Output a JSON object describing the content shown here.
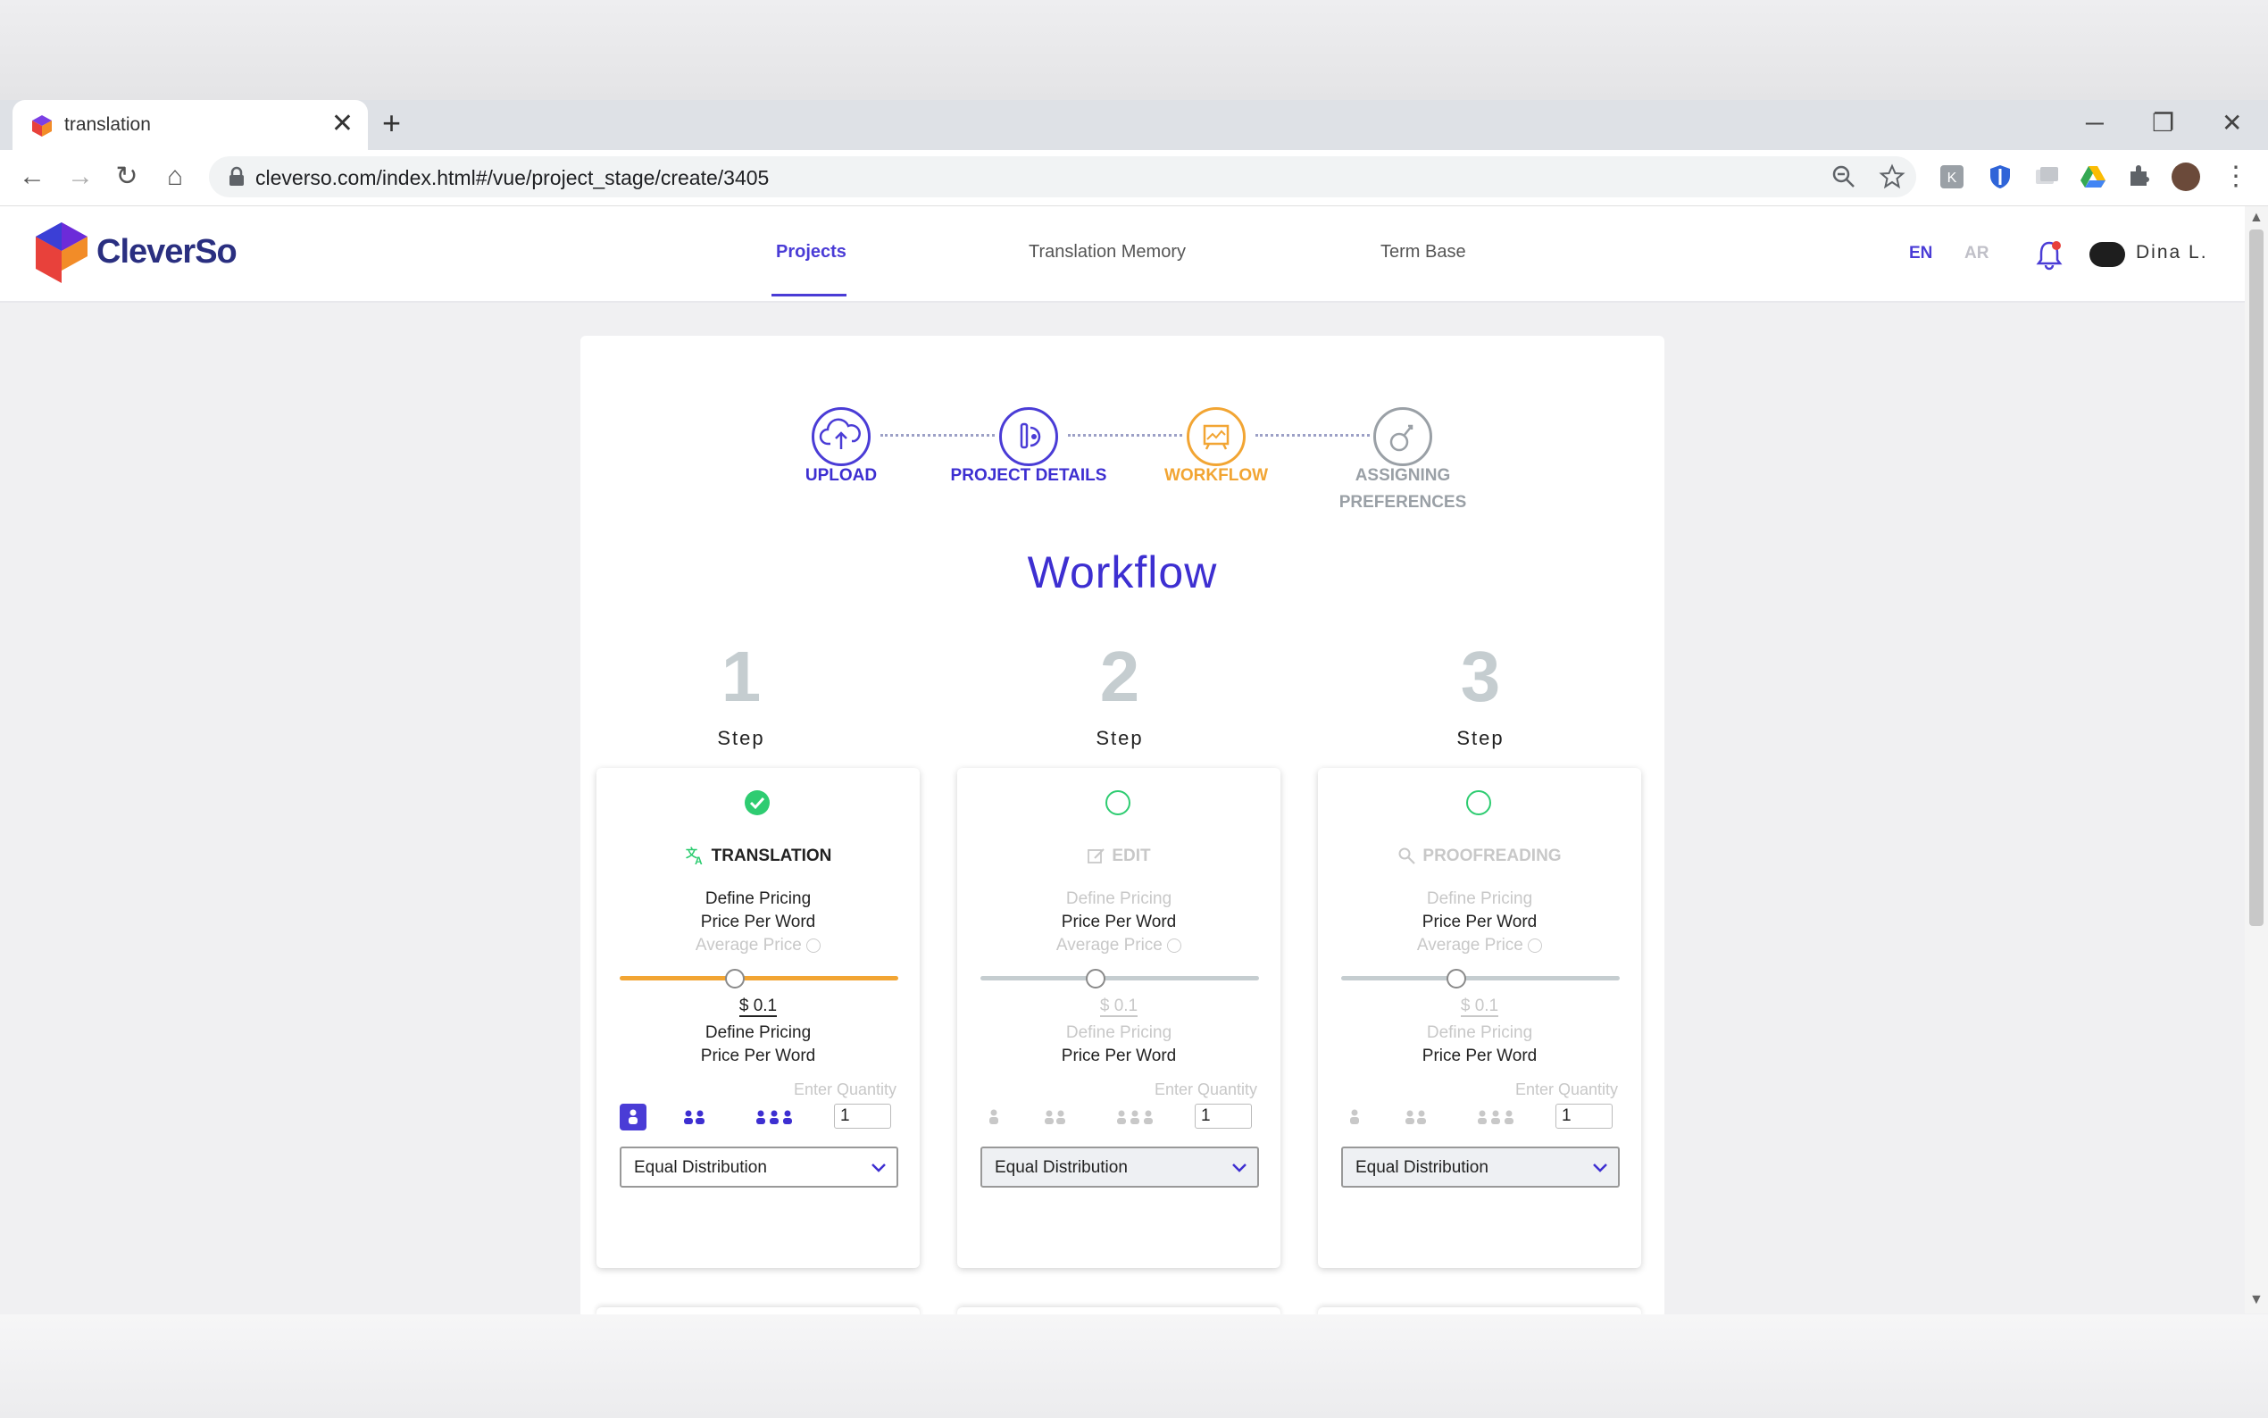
{
  "browser": {
    "tab_title": "translation",
    "url": "cleverso.com/index.html#/vue/project_stage/create/3405",
    "new_tab_symbol": "+",
    "close_symbol": "✕",
    "minimize_symbol": "─",
    "restore_symbol": "❐",
    "window_close_symbol": "✕",
    "back_symbol": "←",
    "forward_symbol": "→",
    "reload_symbol": "↻",
    "home_symbol": "⌂",
    "menu_symbol": "⋮"
  },
  "app": {
    "logo_text": "CleverSo",
    "nav": [
      {
        "label": "Projects",
        "active": true
      },
      {
        "label": "Translation Memory",
        "active": false
      },
      {
        "label": "Term Base",
        "active": false
      }
    ],
    "lang_en": "EN",
    "lang_ar": "AR",
    "user_name": "Dina L.",
    "accent": "#4a3cd6",
    "orange": "#f2a533",
    "green": "#2ecc71"
  },
  "stepper": [
    {
      "label": "UPLOAD",
      "state": "done",
      "icon": "cloud-upload-icon"
    },
    {
      "label": "PROJECT DETAILS",
      "state": "done",
      "icon": "details-icon"
    },
    {
      "label": "WORKFLOW",
      "state": "active",
      "icon": "workflow-icon"
    },
    {
      "label_line1": "ASSIGNING",
      "label_line2": "PREFERENCES",
      "state": "pending",
      "icon": "preferences-icon"
    }
  ],
  "page_title": "Workflow",
  "steps": [
    {
      "number": "1",
      "step_label": "Step",
      "title": "TRANSLATION",
      "enabled": true,
      "slider_value": 0.41,
      "define_pricing": "Define Pricing",
      "price_per_word": "Price Per Word",
      "average_price": "Average Price",
      "price": "$ 0.1",
      "define_pricing_2": "Define Pricing",
      "price_per_word_2": "Price Per Word",
      "enter_quantity": "Enter Quantity",
      "quantity": "1",
      "distribution": "Equal Distribution"
    },
    {
      "number": "2",
      "step_label": "Step",
      "title": "EDIT",
      "enabled": false,
      "slider_value": 0.41,
      "define_pricing": "Define Pricing",
      "price_per_word": "Price Per Word",
      "average_price": "Average Price",
      "price": "$ 0.1",
      "define_pricing_2": "Define Pricing",
      "price_per_word_2": "Price Per Word",
      "enter_quantity": "Enter Quantity",
      "quantity": "1",
      "distribution": "Equal Distribution"
    },
    {
      "number": "3",
      "step_label": "Step",
      "title": "PROOFREADING",
      "enabled": false,
      "slider_value": 0.41,
      "define_pricing": "Define Pricing",
      "price_per_word": "Price Per Word",
      "average_price": "Average Price",
      "price": "$ 0.1",
      "define_pricing_2": "Define Pricing",
      "price_per_word_2": "Price Per Word",
      "enter_quantity": "Enter Quantity",
      "quantity": "1",
      "distribution": "Equal Distribution"
    }
  ]
}
